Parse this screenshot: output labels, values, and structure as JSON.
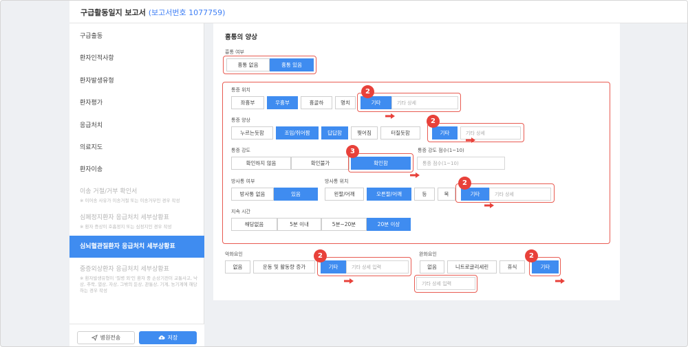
{
  "header": {
    "title": "구급활동일지 보고서",
    "report_no": "(보고서번호 1077759)"
  },
  "sidebar": {
    "items": [
      {
        "label": "구급출동"
      },
      {
        "label": "환자인적사항"
      },
      {
        "label": "환자발생유형"
      },
      {
        "label": "환자평가"
      },
      {
        "label": "응급처치"
      },
      {
        "label": "의료지도"
      },
      {
        "label": "환자이송"
      },
      {
        "label": "이송 거절/거부 확인서",
        "sub": "※ 이어송 사유가 이송거절 또는 이송거부인 경우 작성"
      },
      {
        "label": "심폐정지환자 응급처치 세부상황표",
        "sub": "※ 환자 증상이 호흡정지 또는 심정지인 경우 작성"
      },
      {
        "label": "심뇌혈관질환자 응급처치 세부상황표"
      },
      {
        "label": "중증외상환자 응급처치 세부상황표",
        "sub": "※ 환자발생유형이 '질병 외'인 환자 중 손상기전이 교통사고, 낙상, 추락, 열상, 자상, 그밖의 둔상, 관통상, 기계, 농기계에 해당하는 경우 작성"
      }
    ],
    "send_label": "병원전송",
    "save_label": "저장"
  },
  "form": {
    "section_title": "흉통의 양상",
    "chest_pain_label": "흉통 여부",
    "chest_pain_options": [
      "흉통 없음",
      "흉통 있음"
    ],
    "location_label": "통증 위치",
    "location_options": [
      "좌흉부",
      "우흉부",
      "흉골하",
      "명치",
      "기타"
    ],
    "location_placeholder": "기타 상세",
    "pattern_label": "통증 양상",
    "pattern_options": [
      "누르는듯함",
      "조임/쥐어짬",
      "답답함",
      "찢어짐",
      "터질듯함",
      "기타"
    ],
    "pattern_placeholder": "기타 상세",
    "intensity_label": "통증 강도",
    "intensity_options": [
      "확인하지 않음",
      "확인불가",
      "확인함"
    ],
    "score_label": "통증 강도 점수(1~10)",
    "score_placeholder": "통증 점수(1~10)",
    "radiation_label": "방사통 여부",
    "radiation_options": [
      "방사통 없음",
      "있음"
    ],
    "radiation_loc_label": "방사통 위치",
    "radiation_loc_options": [
      "왼팔/어깨",
      "오른팔/어깨",
      "등",
      "목",
      "기타"
    ],
    "radiation_loc_placeholder": "기타 상세",
    "duration_label": "지속 시간",
    "duration_options": [
      "해당없음",
      "5분 이내",
      "5분~20분",
      "20분 이상"
    ],
    "aggravating_label": "악화요인",
    "aggravating_options": [
      "없음",
      "운동 및 활동량 증가",
      "기타"
    ],
    "aggravating_placeholder": "기타 상세 입력",
    "relieving_label": "완화요인",
    "relieving_options": [
      "없음",
      "니트로글리세린",
      "휴식",
      "기타"
    ],
    "relieving_placeholder": "기타 상세 입력"
  },
  "badges": {
    "b1": "2",
    "b2": "2",
    "b3": "3",
    "b4": "2",
    "b5": "2",
    "b6": "2"
  },
  "colors": {
    "accent": "#3f8cf0",
    "annotation": "#e85a50",
    "badge": "#e8413a"
  }
}
